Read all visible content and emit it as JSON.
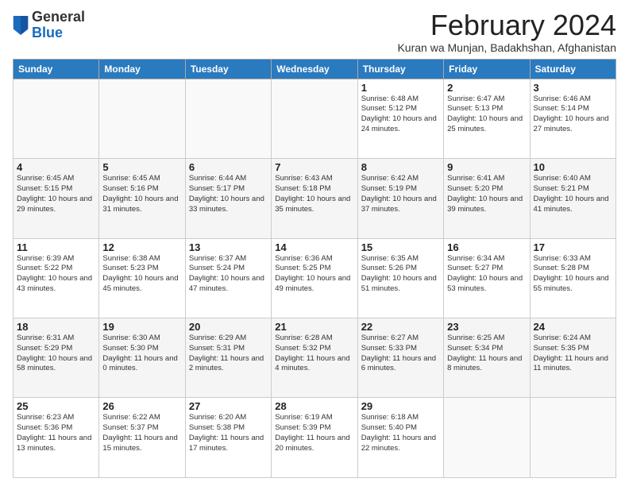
{
  "logo": {
    "general": "General",
    "blue": "Blue"
  },
  "header": {
    "title": "February 2024",
    "subtitle": "Kuran wa Munjan, Badakhshan, Afghanistan"
  },
  "weekdays": [
    "Sunday",
    "Monday",
    "Tuesday",
    "Wednesday",
    "Thursday",
    "Friday",
    "Saturday"
  ],
  "weeks": [
    [
      {
        "day": "",
        "info": ""
      },
      {
        "day": "",
        "info": ""
      },
      {
        "day": "",
        "info": ""
      },
      {
        "day": "",
        "info": ""
      },
      {
        "day": "1",
        "info": "Sunrise: 6:48 AM\nSunset: 5:12 PM\nDaylight: 10 hours and 24 minutes."
      },
      {
        "day": "2",
        "info": "Sunrise: 6:47 AM\nSunset: 5:13 PM\nDaylight: 10 hours and 25 minutes."
      },
      {
        "day": "3",
        "info": "Sunrise: 6:46 AM\nSunset: 5:14 PM\nDaylight: 10 hours and 27 minutes."
      }
    ],
    [
      {
        "day": "4",
        "info": "Sunrise: 6:45 AM\nSunset: 5:15 PM\nDaylight: 10 hours and 29 minutes."
      },
      {
        "day": "5",
        "info": "Sunrise: 6:45 AM\nSunset: 5:16 PM\nDaylight: 10 hours and 31 minutes."
      },
      {
        "day": "6",
        "info": "Sunrise: 6:44 AM\nSunset: 5:17 PM\nDaylight: 10 hours and 33 minutes."
      },
      {
        "day": "7",
        "info": "Sunrise: 6:43 AM\nSunset: 5:18 PM\nDaylight: 10 hours and 35 minutes."
      },
      {
        "day": "8",
        "info": "Sunrise: 6:42 AM\nSunset: 5:19 PM\nDaylight: 10 hours and 37 minutes."
      },
      {
        "day": "9",
        "info": "Sunrise: 6:41 AM\nSunset: 5:20 PM\nDaylight: 10 hours and 39 minutes."
      },
      {
        "day": "10",
        "info": "Sunrise: 6:40 AM\nSunset: 5:21 PM\nDaylight: 10 hours and 41 minutes."
      }
    ],
    [
      {
        "day": "11",
        "info": "Sunrise: 6:39 AM\nSunset: 5:22 PM\nDaylight: 10 hours and 43 minutes."
      },
      {
        "day": "12",
        "info": "Sunrise: 6:38 AM\nSunset: 5:23 PM\nDaylight: 10 hours and 45 minutes."
      },
      {
        "day": "13",
        "info": "Sunrise: 6:37 AM\nSunset: 5:24 PM\nDaylight: 10 hours and 47 minutes."
      },
      {
        "day": "14",
        "info": "Sunrise: 6:36 AM\nSunset: 5:25 PM\nDaylight: 10 hours and 49 minutes."
      },
      {
        "day": "15",
        "info": "Sunrise: 6:35 AM\nSunset: 5:26 PM\nDaylight: 10 hours and 51 minutes."
      },
      {
        "day": "16",
        "info": "Sunrise: 6:34 AM\nSunset: 5:27 PM\nDaylight: 10 hours and 53 minutes."
      },
      {
        "day": "17",
        "info": "Sunrise: 6:33 AM\nSunset: 5:28 PM\nDaylight: 10 hours and 55 minutes."
      }
    ],
    [
      {
        "day": "18",
        "info": "Sunrise: 6:31 AM\nSunset: 5:29 PM\nDaylight: 10 hours and 58 minutes."
      },
      {
        "day": "19",
        "info": "Sunrise: 6:30 AM\nSunset: 5:30 PM\nDaylight: 11 hours and 0 minutes."
      },
      {
        "day": "20",
        "info": "Sunrise: 6:29 AM\nSunset: 5:31 PM\nDaylight: 11 hours and 2 minutes."
      },
      {
        "day": "21",
        "info": "Sunrise: 6:28 AM\nSunset: 5:32 PM\nDaylight: 11 hours and 4 minutes."
      },
      {
        "day": "22",
        "info": "Sunrise: 6:27 AM\nSunset: 5:33 PM\nDaylight: 11 hours and 6 minutes."
      },
      {
        "day": "23",
        "info": "Sunrise: 6:25 AM\nSunset: 5:34 PM\nDaylight: 11 hours and 8 minutes."
      },
      {
        "day": "24",
        "info": "Sunrise: 6:24 AM\nSunset: 5:35 PM\nDaylight: 11 hours and 11 minutes."
      }
    ],
    [
      {
        "day": "25",
        "info": "Sunrise: 6:23 AM\nSunset: 5:36 PM\nDaylight: 11 hours and 13 minutes."
      },
      {
        "day": "26",
        "info": "Sunrise: 6:22 AM\nSunset: 5:37 PM\nDaylight: 11 hours and 15 minutes."
      },
      {
        "day": "27",
        "info": "Sunrise: 6:20 AM\nSunset: 5:38 PM\nDaylight: 11 hours and 17 minutes."
      },
      {
        "day": "28",
        "info": "Sunrise: 6:19 AM\nSunset: 5:39 PM\nDaylight: 11 hours and 20 minutes."
      },
      {
        "day": "29",
        "info": "Sunrise: 6:18 AM\nSunset: 5:40 PM\nDaylight: 11 hours and 22 minutes."
      },
      {
        "day": "",
        "info": ""
      },
      {
        "day": "",
        "info": ""
      }
    ]
  ]
}
